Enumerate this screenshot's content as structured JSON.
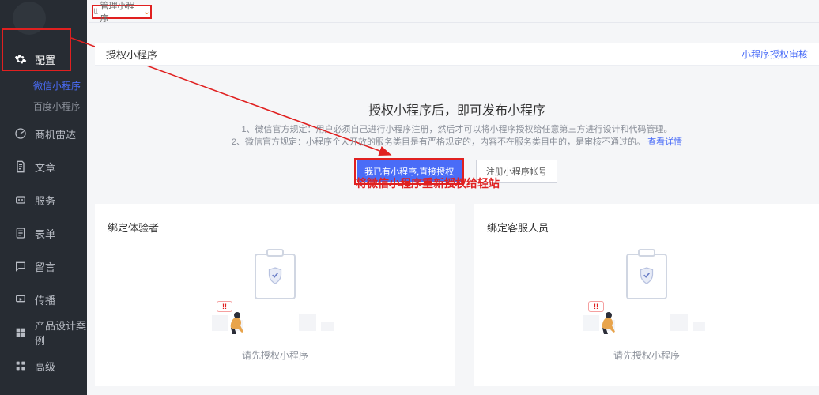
{
  "top_tab": {
    "label": "管理小程序"
  },
  "sidebar": {
    "config": {
      "label": "配置"
    },
    "config_sub1": {
      "label": "微信小程序"
    },
    "config_sub2": {
      "label": "百度小程序"
    },
    "leads": {
      "label": "商机雷达"
    },
    "article": {
      "label": "文章"
    },
    "service": {
      "label": "服务"
    },
    "form": {
      "label": "表单"
    },
    "message": {
      "label": "留言"
    },
    "broadcast": {
      "label": "传播"
    },
    "case": {
      "label": "产品设计案例"
    },
    "advanced": {
      "label": "高级"
    }
  },
  "panel": {
    "title": "授权小程序",
    "right_link": "小程序授权审核"
  },
  "main": {
    "headline": "授权小程序后，即可发布小程序",
    "desc_line1_prefix": "1、微信官方规定：用户必须自己进行小程序注册，然后才可以将小程序授权给任意第三方进行设计和代码管理。",
    "desc_line2_prefix": "2、微信官方规定：小程序个人开放的服务类目是有严格规定的，内容不在服务类目中的，是审核不通过的。",
    "desc_line2_link": "查看详情",
    "btn_primary": "我已有小程序,直接授权",
    "btn_secondary": "注册小程序帐号"
  },
  "annotation": "将微信小程序重新授权给轻站",
  "card_left": {
    "title": "绑定体验者",
    "msg": "请先授权小程序"
  },
  "card_right": {
    "title": "绑定客服人员",
    "msg": "请先授权小程序"
  },
  "excl_text": "!!"
}
